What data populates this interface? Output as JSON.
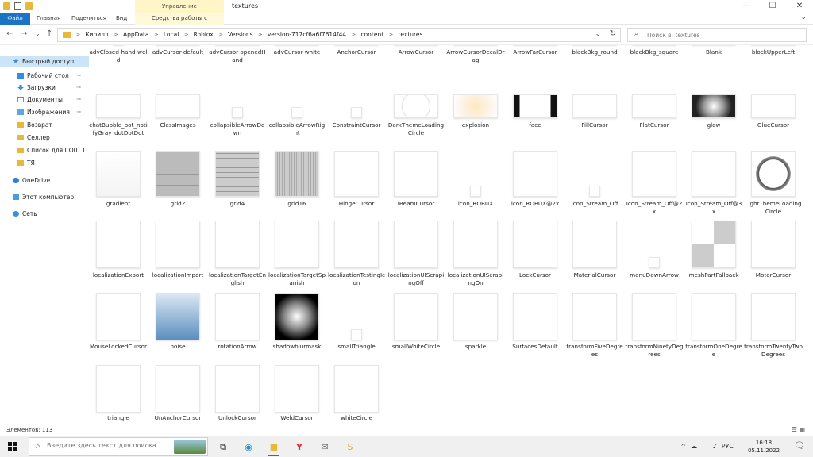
{
  "window": {
    "title": "textures",
    "manage_label": "Управление",
    "min": "—",
    "max": "☐",
    "close": "✕"
  },
  "ribbon": {
    "tabs": [
      "Файл",
      "Главная",
      "Поделиться",
      "Вид",
      "Средства работы с рисунками"
    ],
    "expand": "⌄"
  },
  "nav": {
    "back": "←",
    "forward": "→",
    "recent": "⌄",
    "up": "↑",
    "breadcrumbs": [
      "Кирилл",
      "AppData",
      "Local",
      "Roblox",
      "Versions",
      "version-717cf6a6f7614f44",
      "content",
      "textures"
    ],
    "separator": ">",
    "dropdown": "⌄",
    "refresh": "↻",
    "search_placeholder": "Поиск в: textures"
  },
  "sidebar": {
    "items": [
      {
        "label": "Быстрый доступ",
        "icon": "star-icon",
        "pinned": false,
        "active": true
      },
      {
        "label": "Рабочий стол",
        "icon": "desktop-icon",
        "pinned": true
      },
      {
        "label": "Загрузки",
        "icon": "downloads-icon",
        "pinned": true
      },
      {
        "label": "Документы",
        "icon": "documents-icon",
        "pinned": true
      },
      {
        "label": "Изображения",
        "icon": "pictures-icon",
        "pinned": true
      },
      {
        "label": "Возврат",
        "icon": "folder-icon",
        "pinned": false
      },
      {
        "label": "Селлер",
        "icon": "folder-icon",
        "pinned": false
      },
      {
        "label": "Список для СОШ 1.",
        "icon": "folder-icon",
        "pinned": false
      },
      {
        "label": "ТЯ",
        "icon": "folder-icon",
        "pinned": false
      },
      {
        "label": "OneDrive",
        "icon": "onedrive-icon",
        "pinned": false
      },
      {
        "label": "Этот компьютер",
        "icon": "computer-icon",
        "pinned": false
      },
      {
        "label": "Сеть",
        "icon": "network-icon",
        "pinned": false
      }
    ],
    "pin_glyph": "📌"
  },
  "files": {
    "row0": [
      "advClosed-hand-weld",
      "advCursor-default",
      "advCursor-openedHand",
      "advCursor-white",
      "AnchorCursor",
      "ArrowCursor",
      "ArrowCursorDecalDrag",
      "ArrowFarCursor",
      "blackBkg_round",
      "blackBkg_square",
      "Blank",
      "blockUpperLeft"
    ],
    "row1": [
      "chatBubble_bot_notifyGray_dotDotDot",
      "ClassImages",
      "collapsibleArrowDown",
      "collapsibleArrowRight",
      "ConstraintCursor",
      "DarkThemeLoadingCircle",
      "explosion",
      "face",
      "FillCursor",
      "FlatCursor",
      "glow",
      "GlueCursor"
    ],
    "row2": [
      "gradient",
      "grid2",
      "grid4",
      "grid16",
      "HingeCursor",
      "IBeamCursor",
      "icon_ROBUX",
      "icon_ROBUX@2x",
      "Icon_Stream_Off",
      "Icon_Stream_Off@2x",
      "Icon_Stream_Off@3x",
      "LightThemeLoadingCircle"
    ],
    "row3": [
      "localizationExport",
      "localizationImport",
      "localizationTargetEnglish",
      "localizationTargetSpanish",
      "localizationTestingIcon",
      "localizationUIScrapingOff",
      "localizationUIScrapingOn",
      "LockCursor",
      "MaterialCursor",
      "menuDownArrow",
      "meshPartFallback",
      "MotorCursor"
    ],
    "row4": [
      "MouseLockedCursor",
      "noise",
      "rotationArrow",
      "shadowblurmask",
      "smallTriangle",
      "smallWhiteCircle",
      "sparkle",
      "SurfacesDefault",
      "transformFiveDegrees",
      "transformNinetyDegrees",
      "transformOneDegree",
      "transformTwentyTwoDegrees"
    ],
    "row5": [
      "triangle",
      "UnAnchorCursor",
      "UnlockCursor",
      "WeldCursor",
      "whiteCircle"
    ]
  },
  "status": {
    "count": "Элементов: 113",
    "view_details": "☰",
    "view_icons": "▦"
  },
  "taskbar": {
    "search_placeholder": "Введите здесь текст для поиска",
    "language": "РУС",
    "time": "16:18",
    "date": "05.11.2022",
    "tray_up": "^",
    "notify": "🗨"
  },
  "colors": {
    "accent": "#1a73c6",
    "selected": "#cce4f7",
    "manage_tab": "#fff5c7",
    "folder": "#e8b83b"
  }
}
